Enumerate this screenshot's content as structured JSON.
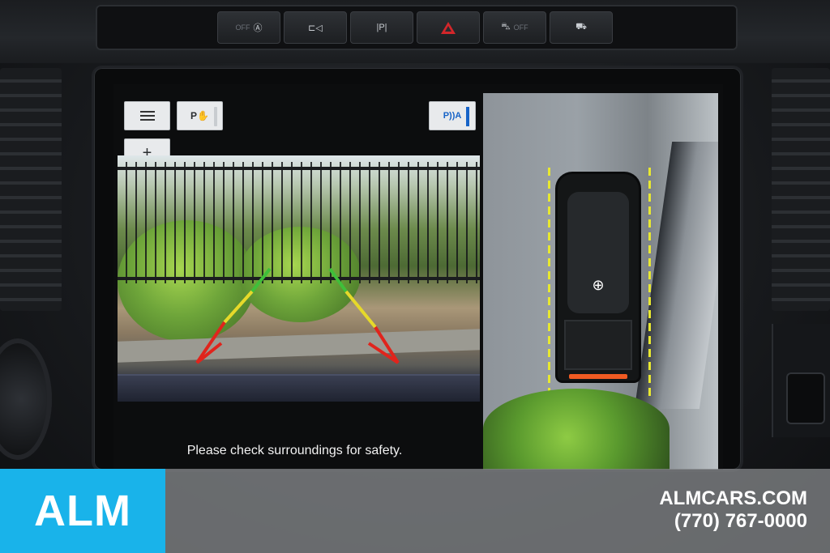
{
  "hardware_buttons": [
    {
      "id": "auto-start-stop",
      "state": "OFF",
      "glyph": "Ⓐ"
    },
    {
      "id": "camera",
      "glyph": "⊏◁"
    },
    {
      "id": "park-assist",
      "glyph": "|P|"
    },
    {
      "id": "hazard",
      "glyph": ""
    },
    {
      "id": "traction-control",
      "state": "OFF",
      "glyph": "⛍"
    },
    {
      "id": "trailer",
      "glyph": "⛟"
    }
  ],
  "screen": {
    "menu_icon": "menu-icon",
    "park_label": "P✋",
    "plus_label": "+",
    "sensor_label": "P))A",
    "safety_message": "Please check surroundings for safety.",
    "zoom_icon": "zoom-in-icon",
    "zoom_glyph": "⊕"
  },
  "colors": {
    "guide_green": "#3fbf3a",
    "guide_yellow": "#e6d92a",
    "guide_red": "#e0241c",
    "taillight": "#f05a22",
    "banner_blue": "#19b3ea"
  },
  "banner": {
    "logo": "ALM",
    "website": "ALMCARS.COM",
    "phone": "(770) 767-0000"
  }
}
